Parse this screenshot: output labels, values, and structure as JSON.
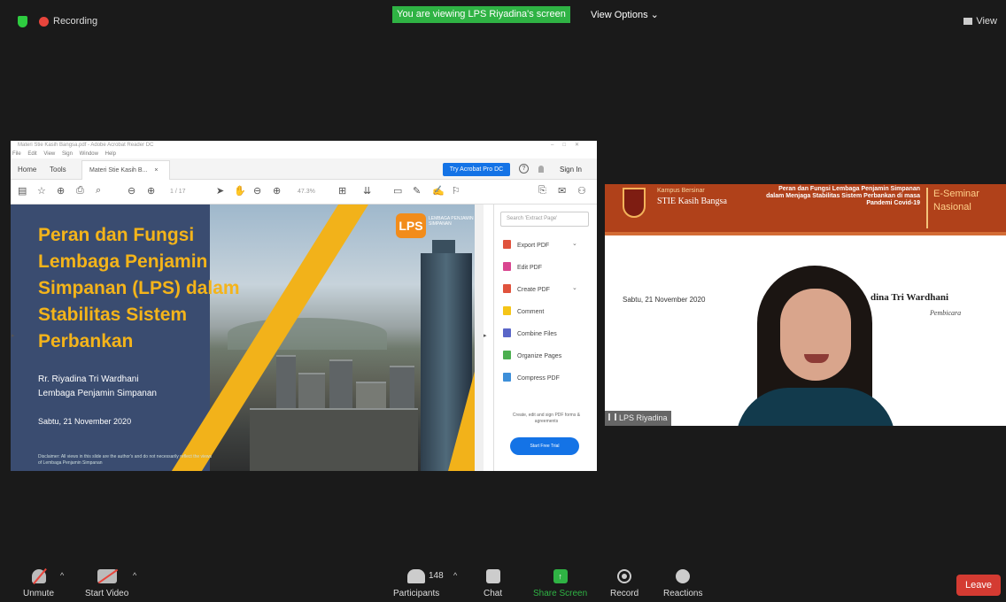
{
  "topbar": {
    "recording_label": "Recording",
    "viewing_banner": "You are viewing LPS Riyadina's screen",
    "view_options_label": "View Options",
    "view_label": "View"
  },
  "acrobat": {
    "window_title": "Materi Stie Kasih Bangsa.pdf - Adobe Acrobat Reader DC",
    "menu": [
      "File",
      "Edit",
      "View",
      "Sign",
      "Window",
      "Help"
    ],
    "tabs": {
      "home": "Home",
      "tools": "Tools",
      "document": "Materi Stie Kasih B...",
      "close": "×"
    },
    "try_button": "Try Acrobat Pro DC",
    "sign_in": "Sign In",
    "toolbar": {
      "page": "1 / 17",
      "zoom": "47.3%"
    },
    "search_placeholder": "Search 'Extract Page'",
    "tools": [
      {
        "label": "Export PDF",
        "color": "#e0533d"
      },
      {
        "label": "Edit PDF",
        "color": "#d94690"
      },
      {
        "label": "Create PDF",
        "color": "#e0533d"
      },
      {
        "label": "Comment",
        "color": "#f5c518"
      },
      {
        "label": "Combine Files",
        "color": "#5a66c8"
      },
      {
        "label": "Organize Pages",
        "color": "#4caf50"
      },
      {
        "label": "Compress PDF",
        "color": "#3d8fd9"
      }
    ],
    "tools_note": "Create, edit and sign PDF forms & agreements",
    "start_trial": "Start Free Trial"
  },
  "slide": {
    "title": "Peran dan Fungsi Lembaga Penjamin Simpanan (LPS) dalam Stabilitas Sistem Perbankan",
    "presenter": "Rr. Riyadina Tri Wardhani",
    "organization": "Lembaga Penjamin Simpanan",
    "date": "Sabtu, 21 November 2020",
    "disclaimer": "Disclaimer: All views in this slide are the author's and do not necessarily reflect the views of Lembaga Penjamin Simpanan",
    "logo_text": "LPS",
    "logo_subtext": "LEMBAGA PENJAMIN SIMPANAN"
  },
  "camera": {
    "campus_sub": "Kampus Bersinar",
    "campus_name": "STIE Kasih Bangsa",
    "topic": "Peran dan Fungsi Lembaga Penjamin Simpanan dalam Menjaga Stabilitas Sistem Perbankan di masa Pandemi Covid-19",
    "seminar_label": "E-Seminar Nasional",
    "date": "Sabtu, 21 November 2020",
    "speaker": "dina Tri Wardhani",
    "role": "Pembicara",
    "participant_name": "LPS Riyadina"
  },
  "bottombar": {
    "unmute": "Unmute",
    "start_video": "Start Video",
    "participants": "Participants",
    "participant_count": "148",
    "chat": "Chat",
    "share_screen": "Share Screen",
    "record": "Record",
    "reactions": "Reactions",
    "leave": "Leave"
  },
  "colors": {
    "zoom_green": "#2fb344",
    "leave_red": "#d43b32",
    "slide_navy": "#3a4c70",
    "slide_gold": "#f4b41a",
    "acrobat_blue": "#1473e6"
  }
}
